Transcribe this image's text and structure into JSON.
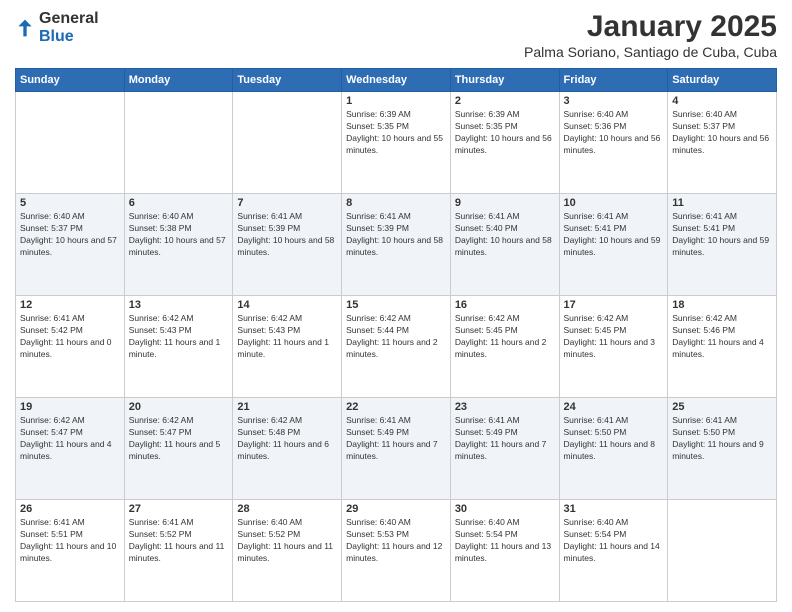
{
  "header": {
    "logo": {
      "general": "General",
      "blue": "Blue"
    },
    "title": "January 2025",
    "location": "Palma Soriano, Santiago de Cuba, Cuba"
  },
  "days_of_week": [
    "Sunday",
    "Monday",
    "Tuesday",
    "Wednesday",
    "Thursday",
    "Friday",
    "Saturday"
  ],
  "weeks": [
    {
      "days": [
        {
          "number": "",
          "sunrise": "",
          "sunset": "",
          "daylight": ""
        },
        {
          "number": "",
          "sunrise": "",
          "sunset": "",
          "daylight": ""
        },
        {
          "number": "",
          "sunrise": "",
          "sunset": "",
          "daylight": ""
        },
        {
          "number": "1",
          "sunrise": "Sunrise: 6:39 AM",
          "sunset": "Sunset: 5:35 PM",
          "daylight": "Daylight: 10 hours and 55 minutes."
        },
        {
          "number": "2",
          "sunrise": "Sunrise: 6:39 AM",
          "sunset": "Sunset: 5:35 PM",
          "daylight": "Daylight: 10 hours and 56 minutes."
        },
        {
          "number": "3",
          "sunrise": "Sunrise: 6:40 AM",
          "sunset": "Sunset: 5:36 PM",
          "daylight": "Daylight: 10 hours and 56 minutes."
        },
        {
          "number": "4",
          "sunrise": "Sunrise: 6:40 AM",
          "sunset": "Sunset: 5:37 PM",
          "daylight": "Daylight: 10 hours and 56 minutes."
        }
      ]
    },
    {
      "days": [
        {
          "number": "5",
          "sunrise": "Sunrise: 6:40 AM",
          "sunset": "Sunset: 5:37 PM",
          "daylight": "Daylight: 10 hours and 57 minutes."
        },
        {
          "number": "6",
          "sunrise": "Sunrise: 6:40 AM",
          "sunset": "Sunset: 5:38 PM",
          "daylight": "Daylight: 10 hours and 57 minutes."
        },
        {
          "number": "7",
          "sunrise": "Sunrise: 6:41 AM",
          "sunset": "Sunset: 5:39 PM",
          "daylight": "Daylight: 10 hours and 58 minutes."
        },
        {
          "number": "8",
          "sunrise": "Sunrise: 6:41 AM",
          "sunset": "Sunset: 5:39 PM",
          "daylight": "Daylight: 10 hours and 58 minutes."
        },
        {
          "number": "9",
          "sunrise": "Sunrise: 6:41 AM",
          "sunset": "Sunset: 5:40 PM",
          "daylight": "Daylight: 10 hours and 58 minutes."
        },
        {
          "number": "10",
          "sunrise": "Sunrise: 6:41 AM",
          "sunset": "Sunset: 5:41 PM",
          "daylight": "Daylight: 10 hours and 59 minutes."
        },
        {
          "number": "11",
          "sunrise": "Sunrise: 6:41 AM",
          "sunset": "Sunset: 5:41 PM",
          "daylight": "Daylight: 10 hours and 59 minutes."
        }
      ]
    },
    {
      "days": [
        {
          "number": "12",
          "sunrise": "Sunrise: 6:41 AM",
          "sunset": "Sunset: 5:42 PM",
          "daylight": "Daylight: 11 hours and 0 minutes."
        },
        {
          "number": "13",
          "sunrise": "Sunrise: 6:42 AM",
          "sunset": "Sunset: 5:43 PM",
          "daylight": "Daylight: 11 hours and 1 minute."
        },
        {
          "number": "14",
          "sunrise": "Sunrise: 6:42 AM",
          "sunset": "Sunset: 5:43 PM",
          "daylight": "Daylight: 11 hours and 1 minute."
        },
        {
          "number": "15",
          "sunrise": "Sunrise: 6:42 AM",
          "sunset": "Sunset: 5:44 PM",
          "daylight": "Daylight: 11 hours and 2 minutes."
        },
        {
          "number": "16",
          "sunrise": "Sunrise: 6:42 AM",
          "sunset": "Sunset: 5:45 PM",
          "daylight": "Daylight: 11 hours and 2 minutes."
        },
        {
          "number": "17",
          "sunrise": "Sunrise: 6:42 AM",
          "sunset": "Sunset: 5:45 PM",
          "daylight": "Daylight: 11 hours and 3 minutes."
        },
        {
          "number": "18",
          "sunrise": "Sunrise: 6:42 AM",
          "sunset": "Sunset: 5:46 PM",
          "daylight": "Daylight: 11 hours and 4 minutes."
        }
      ]
    },
    {
      "days": [
        {
          "number": "19",
          "sunrise": "Sunrise: 6:42 AM",
          "sunset": "Sunset: 5:47 PM",
          "daylight": "Daylight: 11 hours and 4 minutes."
        },
        {
          "number": "20",
          "sunrise": "Sunrise: 6:42 AM",
          "sunset": "Sunset: 5:47 PM",
          "daylight": "Daylight: 11 hours and 5 minutes."
        },
        {
          "number": "21",
          "sunrise": "Sunrise: 6:42 AM",
          "sunset": "Sunset: 5:48 PM",
          "daylight": "Daylight: 11 hours and 6 minutes."
        },
        {
          "number": "22",
          "sunrise": "Sunrise: 6:41 AM",
          "sunset": "Sunset: 5:49 PM",
          "daylight": "Daylight: 11 hours and 7 minutes."
        },
        {
          "number": "23",
          "sunrise": "Sunrise: 6:41 AM",
          "sunset": "Sunset: 5:49 PM",
          "daylight": "Daylight: 11 hours and 7 minutes."
        },
        {
          "number": "24",
          "sunrise": "Sunrise: 6:41 AM",
          "sunset": "Sunset: 5:50 PM",
          "daylight": "Daylight: 11 hours and 8 minutes."
        },
        {
          "number": "25",
          "sunrise": "Sunrise: 6:41 AM",
          "sunset": "Sunset: 5:50 PM",
          "daylight": "Daylight: 11 hours and 9 minutes."
        }
      ]
    },
    {
      "days": [
        {
          "number": "26",
          "sunrise": "Sunrise: 6:41 AM",
          "sunset": "Sunset: 5:51 PM",
          "daylight": "Daylight: 11 hours and 10 minutes."
        },
        {
          "number": "27",
          "sunrise": "Sunrise: 6:41 AM",
          "sunset": "Sunset: 5:52 PM",
          "daylight": "Daylight: 11 hours and 11 minutes."
        },
        {
          "number": "28",
          "sunrise": "Sunrise: 6:40 AM",
          "sunset": "Sunset: 5:52 PM",
          "daylight": "Daylight: 11 hours and 11 minutes."
        },
        {
          "number": "29",
          "sunrise": "Sunrise: 6:40 AM",
          "sunset": "Sunset: 5:53 PM",
          "daylight": "Daylight: 11 hours and 12 minutes."
        },
        {
          "number": "30",
          "sunrise": "Sunrise: 6:40 AM",
          "sunset": "Sunset: 5:54 PM",
          "daylight": "Daylight: 11 hours and 13 minutes."
        },
        {
          "number": "31",
          "sunrise": "Sunrise: 6:40 AM",
          "sunset": "Sunset: 5:54 PM",
          "daylight": "Daylight: 11 hours and 14 minutes."
        },
        {
          "number": "",
          "sunrise": "",
          "sunset": "",
          "daylight": ""
        }
      ]
    }
  ]
}
